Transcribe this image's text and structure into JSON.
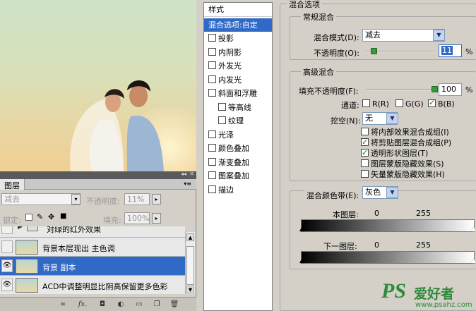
{
  "layers_panel": {
    "tab_label": "图层",
    "blend_mode": "减去",
    "opacity_label": "不透明度:",
    "opacity_value": "11%",
    "lock_label": "锁定:",
    "fill_label": "填充:",
    "fill_value": "100%",
    "layers": [
      {
        "name": "对绿的红外效果",
        "visible": false,
        "selected": false,
        "is_group": true
      },
      {
        "name": "背景本层现出 主色调",
        "visible": false,
        "selected": false,
        "is_group": false
      },
      {
        "name": "背景 副本",
        "visible": true,
        "selected": true,
        "is_group": false
      },
      {
        "name": "ACD中调整明显比阴高保留更多色彩",
        "visible": true,
        "selected": false,
        "is_group": false
      }
    ]
  },
  "styles_list": {
    "header": "样式",
    "items": [
      {
        "label": "混合选项:自定",
        "checkbox": false,
        "checked": false,
        "active": true,
        "sub": false
      },
      {
        "label": "投影",
        "checkbox": true,
        "checked": false,
        "active": false,
        "sub": false
      },
      {
        "label": "内阴影",
        "checkbox": true,
        "checked": false,
        "active": false,
        "sub": false
      },
      {
        "label": "外发光",
        "checkbox": true,
        "checked": false,
        "active": false,
        "sub": false
      },
      {
        "label": "内发光",
        "checkbox": true,
        "checked": false,
        "active": false,
        "sub": false
      },
      {
        "label": "斜面和浮雕",
        "checkbox": true,
        "checked": false,
        "active": false,
        "sub": false
      },
      {
        "label": "等高线",
        "checkbox": true,
        "checked": false,
        "active": false,
        "sub": true
      },
      {
        "label": "纹理",
        "checkbox": true,
        "checked": false,
        "active": false,
        "sub": true
      },
      {
        "label": "光泽",
        "checkbox": true,
        "checked": false,
        "active": false,
        "sub": false
      },
      {
        "label": "颜色叠加",
        "checkbox": true,
        "checked": false,
        "active": false,
        "sub": false
      },
      {
        "label": "渐变叠加",
        "checkbox": true,
        "checked": false,
        "active": false,
        "sub": false
      },
      {
        "label": "图案叠加",
        "checkbox": true,
        "checked": false,
        "active": false,
        "sub": false
      },
      {
        "label": "描边",
        "checkbox": true,
        "checked": false,
        "active": false,
        "sub": false
      }
    ]
  },
  "blending_options": {
    "title": "混合选项",
    "general": {
      "title": "常规混合",
      "mode_label": "混合模式(D):",
      "mode_value": "减去",
      "opacity_label": "不透明度(O):",
      "opacity_value": "11",
      "opacity_fraction": 0.11,
      "unit": "%"
    },
    "advanced": {
      "title": "高级混合",
      "fill_label": "填充不透明度(F):",
      "fill_value": "100",
      "fill_fraction": 1.0,
      "unit": "%",
      "channels_label": "通道:",
      "channels": [
        {
          "label": "R(R)",
          "checked": false
        },
        {
          "label": "G(G)",
          "checked": false
        },
        {
          "label": "B(B)",
          "checked": true
        }
      ],
      "knockout_label": "挖空(N):",
      "knockout_value": "无",
      "options": [
        {
          "label": "将内部效果混合成组(I)",
          "checked": false
        },
        {
          "label": "将剪贴图层混合成组(P)",
          "checked": true
        },
        {
          "label": "透明形状图层(T)",
          "checked": true
        },
        {
          "label": "图层蒙版隐藏效果(S)",
          "checked": false
        },
        {
          "label": "矢量蒙版隐藏效果(H)",
          "checked": false
        }
      ]
    },
    "blend_if": {
      "label": "混合颜色带(E):",
      "value": "灰色",
      "this_layer_label": "本图层:",
      "this_layer_low": "0",
      "this_layer_high": "255",
      "underlying_label": "下一图层:",
      "underlying_low": "0",
      "underlying_high": "255"
    }
  },
  "watermark": {
    "logo": "PS",
    "text": "爱好者",
    "url": "www.psahz.com"
  },
  "colors": {
    "selection": "#3169c6",
    "panel_bg": "#d4d0c8",
    "knob": "#3a9a3a"
  }
}
